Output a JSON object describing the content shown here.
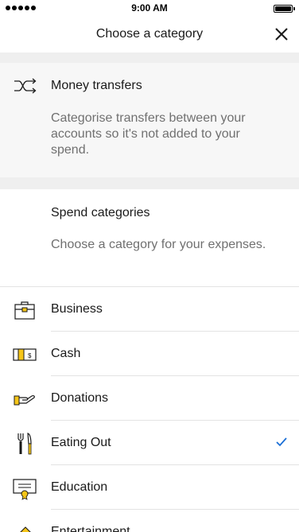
{
  "status_bar": {
    "time": "9:00 AM"
  },
  "header": {
    "title": "Choose a category"
  },
  "money_transfers": {
    "title": "Money transfers",
    "description": "Categorise transfers between your accounts so it's not added to your spend."
  },
  "spend_categories": {
    "title": "Spend categories",
    "description": "Choose a category for your expenses."
  },
  "categories": [
    {
      "label": "Business",
      "icon": "briefcase-icon",
      "selected": false
    },
    {
      "label": "Cash",
      "icon": "cash-icon",
      "selected": false
    },
    {
      "label": "Donations",
      "icon": "donation-hand-icon",
      "selected": false
    },
    {
      "label": "Eating Out",
      "icon": "cutlery-icon",
      "selected": true
    },
    {
      "label": "Education",
      "icon": "certificate-icon",
      "selected": false
    },
    {
      "label": "Entertainment",
      "icon": "ticket-icon",
      "selected": false
    }
  ],
  "colors": {
    "accent": "#f5c518",
    "check": "#1b6fd6",
    "muted": "#707070"
  }
}
